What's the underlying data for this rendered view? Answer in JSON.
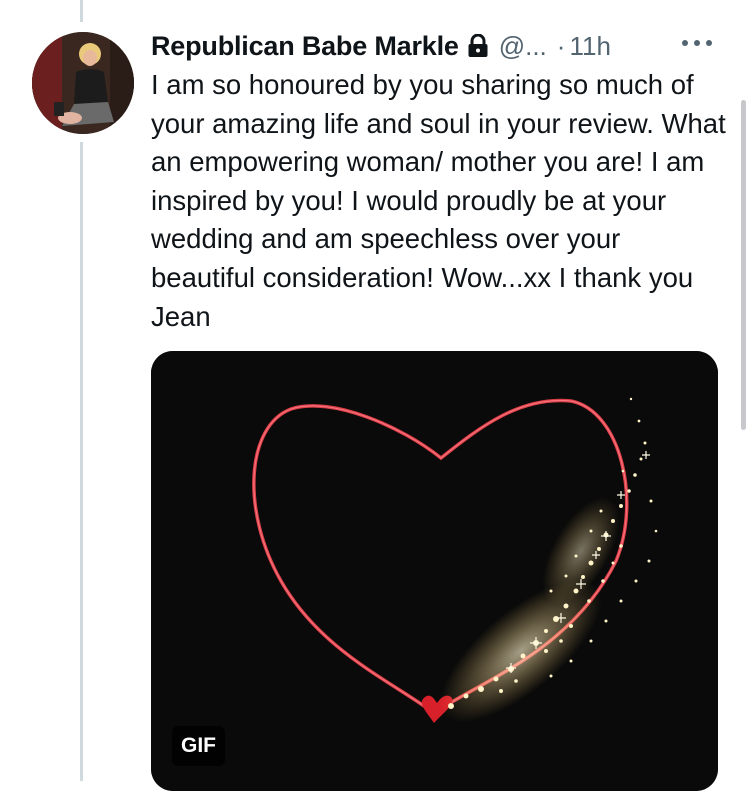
{
  "tweet": {
    "display_name": "Republican Babe Markle",
    "handle": "@...",
    "separator": "·",
    "timestamp": "11h",
    "text": "I am so honoured by you sharing so much of your amazing life and soul in your review. What an empowering woman/ mother you are! I am inspired by you! I would proudly be at your wedding and am speechless over your beautiful consideration! Wow...xx I thank you Jean",
    "protected_icon": "lock-icon",
    "more_icon": "more-horizontal-icon"
  },
  "media": {
    "badge": "GIF",
    "content_icon": "sparkling-heart",
    "colors": {
      "background": "#0a0a0a",
      "heart_outline": "#e8424c",
      "sparkle": "#ffe8a8"
    }
  },
  "colors": {
    "text_primary": "#0f1419",
    "text_secondary": "#536471",
    "thread_line": "#cfd9de"
  }
}
